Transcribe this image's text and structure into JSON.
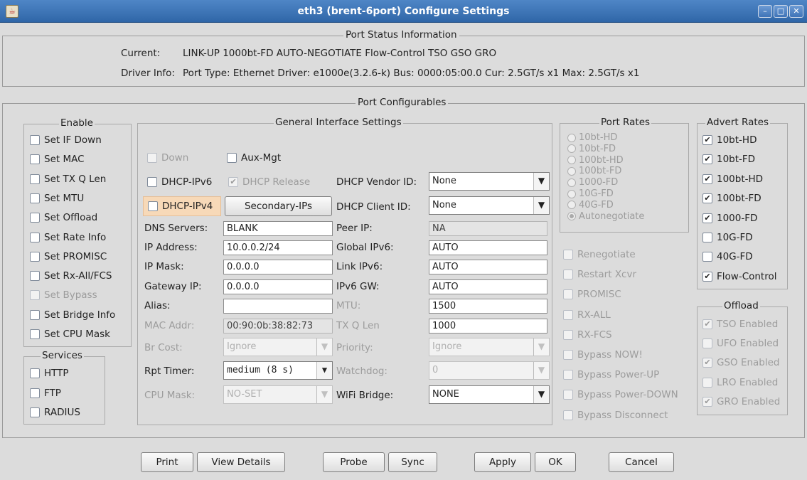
{
  "window": {
    "title": "eth3  (brent-6port) Configure Settings",
    "app_icon": "java-icon"
  },
  "status": {
    "section_title": "Port Status Information",
    "current_label": "Current:",
    "current_value": "LINK-UP 1000bt-FD AUTO-NEGOTIATE Flow-Control TSO GSO GRO",
    "driver_label": "Driver Info:",
    "driver_value": "Port Type: Ethernet   Driver: e1000e(3.2.6-k)  Bus: 0000:05:00.0  Cur: 2.5GT/s x1  Max: 2.5GT/s x1"
  },
  "configurables": {
    "section_title": "Port Configurables"
  },
  "enable": {
    "title": "Enable",
    "items": [
      {
        "label": "Set IF Down",
        "checked": false,
        "disabled": false
      },
      {
        "label": "Set MAC",
        "checked": false,
        "disabled": false
      },
      {
        "label": "Set TX Q Len",
        "checked": false,
        "disabled": false
      },
      {
        "label": "Set MTU",
        "checked": false,
        "disabled": false
      },
      {
        "label": "Set Offload",
        "checked": false,
        "disabled": false
      },
      {
        "label": "Set Rate Info",
        "checked": false,
        "disabled": false
      },
      {
        "label": "Set PROMISC",
        "checked": false,
        "disabled": false
      },
      {
        "label": "Set Rx-All/FCS",
        "checked": false,
        "disabled": false
      },
      {
        "label": "Set Bypass",
        "checked": false,
        "disabled": true
      },
      {
        "label": "Set Bridge Info",
        "checked": false,
        "disabled": false
      },
      {
        "label": "Set CPU Mask",
        "checked": false,
        "disabled": false
      }
    ]
  },
  "services": {
    "title": "Services",
    "items": [
      {
        "label": "HTTP",
        "checked": false
      },
      {
        "label": "FTP",
        "checked": false
      },
      {
        "label": "RADIUS",
        "checked": false
      }
    ]
  },
  "general": {
    "title": "General Interface Settings",
    "down_label": "Down",
    "aux_mgt_label": "Aux-Mgt",
    "dhcp_ipv6_label": "DHCP-IPv6",
    "dhcp_release_label": "DHCP Release",
    "dhcp_release_check": "✔",
    "dhcp_ipv4_label": "DHCP-IPv4",
    "secondary_ips_label": "Secondary-IPs",
    "dhcp_vendor_id_label": "DHCP Vendor ID:",
    "dhcp_vendor_id_value": "None",
    "dhcp_client_id_label": "DHCP Client ID:",
    "dhcp_client_id_value": "None",
    "dns_servers_label": "DNS Servers:",
    "dns_servers_value": "BLANK",
    "peer_ip_label": "Peer IP:",
    "peer_ip_value": "NA",
    "ip_address_label": "IP Address:",
    "ip_address_value": "10.0.0.2/24",
    "global_ipv6_label": "Global IPv6:",
    "global_ipv6_value": "AUTO",
    "ip_mask_label": "IP Mask:",
    "ip_mask_value": "0.0.0.0",
    "link_ipv6_label": "Link IPv6:",
    "link_ipv6_value": "AUTO",
    "gateway_ip_label": "Gateway IP:",
    "gateway_ip_value": "0.0.0.0",
    "ipv6_gw_label": "IPv6 GW:",
    "ipv6_gw_value": "AUTO",
    "alias_label": "Alias:",
    "alias_value": "",
    "mtu_label": "MTU:",
    "mtu_value": "1500",
    "mac_addr_label": "MAC Addr:",
    "mac_addr_value": "00:90:0b:38:82:73",
    "tx_q_len_label": "TX Q Len",
    "tx_q_len_value": "1000",
    "br_cost_label": "Br Cost:",
    "br_cost_value": "Ignore",
    "priority_label": "Priority:",
    "priority_value": "Ignore",
    "rpt_timer_label": "Rpt Timer:",
    "rpt_timer_value": "medium  (8 s)",
    "watchdog_label": "Watchdog:",
    "watchdog_value": "0",
    "cpu_mask_label": "CPU Mask:",
    "cpu_mask_value": "NO-SET",
    "wifi_bridge_label": "WiFi Bridge:",
    "wifi_bridge_value": "NONE"
  },
  "port_rates": {
    "title": "Port Rates",
    "items": [
      "10bt-HD",
      "10bt-FD",
      "100bt-HD",
      "100bt-FD",
      "1000-FD",
      "10G-FD",
      "40G-FD",
      "Autonegotiate"
    ],
    "selected": "Autonegotiate"
  },
  "misc_options": {
    "items": [
      "Renegotiate",
      "Restart Xcvr",
      "PROMISC",
      "RX-ALL",
      "RX-FCS",
      "Bypass NOW!",
      "Bypass Power-UP",
      "Bypass Power-DOWN",
      "Bypass Disconnect"
    ]
  },
  "advert_rates": {
    "title": "Advert Rates",
    "items": [
      {
        "label": "10bt-HD",
        "checked": true
      },
      {
        "label": "10bt-FD",
        "checked": true
      },
      {
        "label": "100bt-HD",
        "checked": true
      },
      {
        "label": "100bt-FD",
        "checked": true
      },
      {
        "label": "1000-FD",
        "checked": true
      },
      {
        "label": "10G-FD",
        "checked": false
      },
      {
        "label": "40G-FD",
        "checked": false
      },
      {
        "label": "Flow-Control",
        "checked": true
      }
    ]
  },
  "offload": {
    "title": "Offload",
    "items": [
      {
        "label": "TSO Enabled",
        "checked": true
      },
      {
        "label": "UFO Enabled",
        "checked": false
      },
      {
        "label": "GSO Enabled",
        "checked": true
      },
      {
        "label": "LRO Enabled",
        "checked": false
      },
      {
        "label": "GRO Enabled",
        "checked": true
      }
    ]
  },
  "buttons": {
    "print": "Print",
    "view_details": "View Details",
    "probe": "Probe",
    "sync": "Sync",
    "apply": "Apply",
    "ok": "OK",
    "cancel": "Cancel"
  },
  "glyphs": {
    "check": "✔",
    "dropdown": "▼",
    "minimize": "–",
    "maximize": "□",
    "close": "✕"
  }
}
